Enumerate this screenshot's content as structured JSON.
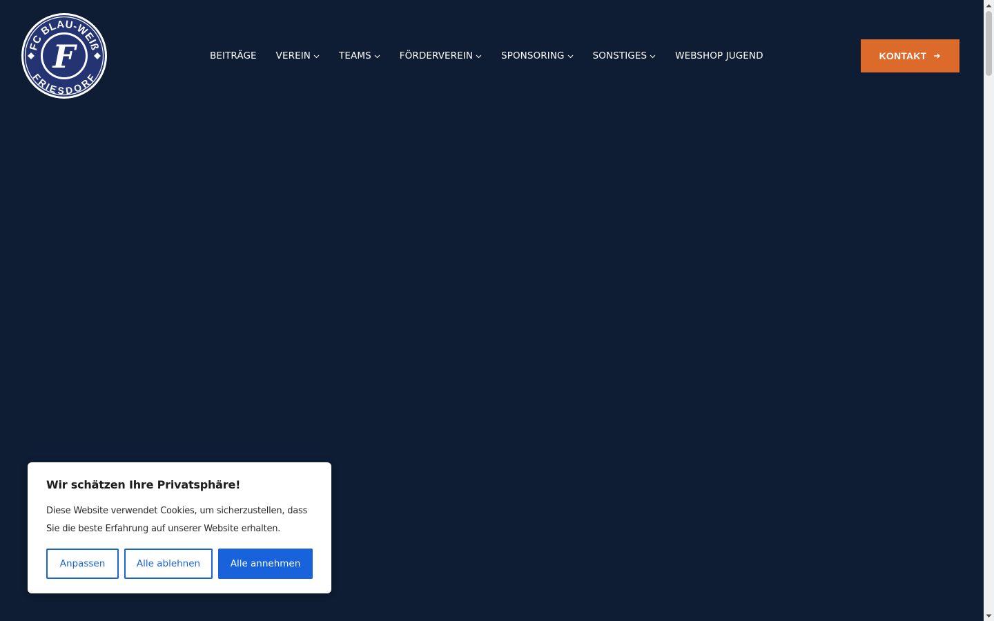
{
  "header": {
    "logo": {
      "top_text": "FC BLAU-WEIß",
      "bottom_text": "FRIESDORF",
      "monogram": "F",
      "icon": "club-crest-icon"
    },
    "nav": [
      {
        "label": "BEITRÄGE",
        "has_dropdown": false
      },
      {
        "label": "VEREIN",
        "has_dropdown": true
      },
      {
        "label": "TEAMS",
        "has_dropdown": true
      },
      {
        "label": "FÖRDERVEREIN",
        "has_dropdown": true
      },
      {
        "label": "SPONSORING",
        "has_dropdown": true
      },
      {
        "label": "SONSTIGES",
        "has_dropdown": true
      },
      {
        "label": "WEBSHOP JUGEND",
        "has_dropdown": false
      }
    ],
    "cta": {
      "label": "KONTAKT",
      "icon": "arrow-right-icon"
    }
  },
  "cookie_banner": {
    "title": "Wir schätzen Ihre Privatsphäre!",
    "text": "Diese Website verwendet Cookies, um sicherzustellen, dass Sie die beste Erfahrung auf unserer Website erhalten.",
    "buttons": {
      "customize": "Anpassen",
      "reject": "Alle ablehnen",
      "accept": "Alle annehmen"
    }
  },
  "colors": {
    "background": "#0e1d33",
    "accent_orange": "#dc6a2b",
    "primary_blue": "#1863dc",
    "logo_navy": "#1f2f6e"
  }
}
